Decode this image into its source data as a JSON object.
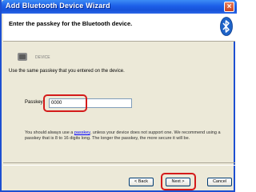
{
  "window": {
    "title": "Add Bluetooth Device Wizard",
    "close_label": "×"
  },
  "header": {
    "title": "Enter the passkey for the Bluetooth device.",
    "icon": "bluetooth-icon"
  },
  "device": {
    "icon": "device-icon",
    "name": "DEVICE"
  },
  "instructions": "Use the same passkey that you entered on the device.",
  "passkey": {
    "label": "Passkey:",
    "value": "0000"
  },
  "hint": {
    "before": "You should always use a ",
    "link": "passkey",
    "after": ", unless your device does not support one. We recommend using a passkey that is 8 to 16 digits long. The longer the passkey, the more secure it will be."
  },
  "buttons": {
    "back": "< Back",
    "next": "Next >",
    "cancel": "Cancel"
  },
  "colors": {
    "titlebar": "#1c5ee8",
    "highlight": "#d41a1a",
    "link": "#0000ff"
  }
}
